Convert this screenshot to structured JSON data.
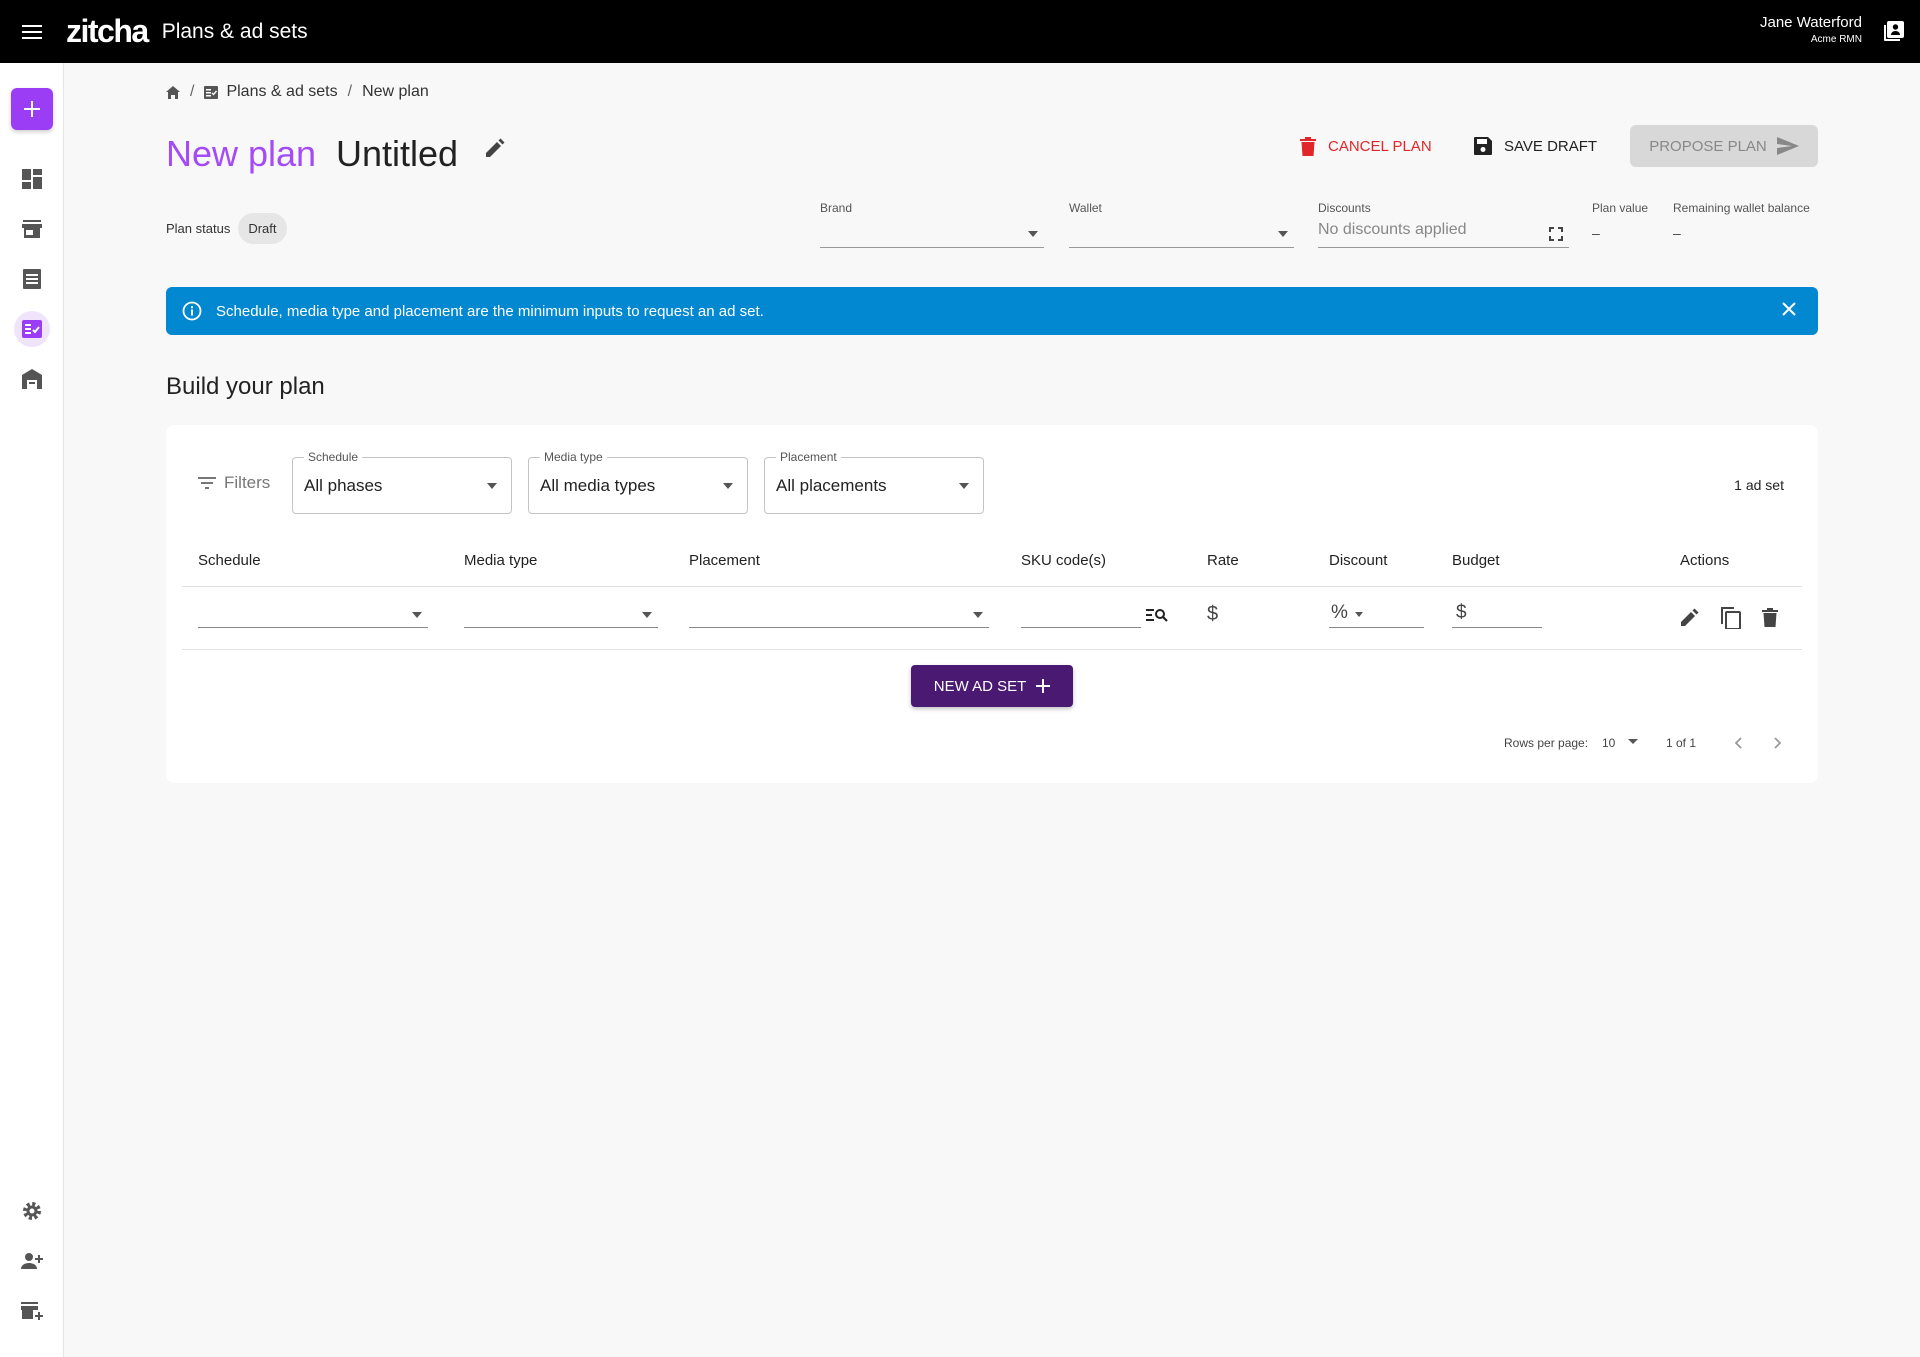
{
  "topbar": {
    "logo": "zitcha",
    "title": "Plans & ad sets",
    "user_name": "Jane Waterford",
    "user_org": "Acme RMN"
  },
  "breadcrumb": {
    "plans": "Plans & ad sets",
    "sep": "/",
    "current": "New plan"
  },
  "header": {
    "new_label": "New plan",
    "plan_name": "Untitled",
    "cancel": "CANCEL PLAN",
    "save": "SAVE DRAFT",
    "propose": "PROPOSE PLAN"
  },
  "status": {
    "label": "Plan status",
    "value": "Draft"
  },
  "fields": {
    "brand": {
      "label": "Brand",
      "value": ""
    },
    "wallet": {
      "label": "Wallet",
      "value": ""
    },
    "discounts": {
      "label": "Discounts",
      "placeholder": "No discounts applied"
    },
    "plan_value": {
      "label": "Plan value",
      "value": "–"
    },
    "wallet_balance": {
      "label": "Remaining wallet balance",
      "value": "–"
    }
  },
  "alert": {
    "text": "Schedule, media type and placement are the minimum inputs to request an ad set."
  },
  "section": {
    "title": "Build your plan"
  },
  "filters": {
    "label": "Filters",
    "schedule": {
      "label": "Schedule",
      "value": "All phases"
    },
    "media_type": {
      "label": "Media type",
      "value": "All media types"
    },
    "placement": {
      "label": "Placement",
      "value": "All placements"
    },
    "count": "1 ad set"
  },
  "table": {
    "headers": {
      "schedule": "Schedule",
      "media_type": "Media type",
      "placement": "Placement",
      "sku": "SKU code(s)",
      "rate": "Rate",
      "discount": "Discount",
      "budget": "Budget",
      "actions": "Actions"
    },
    "row": {
      "rate_symbol": "$",
      "discount_symbol": "%",
      "budget_symbol": "$"
    }
  },
  "new_ad_set": "NEW AD SET",
  "pagination": {
    "rows_label": "Rows per page:",
    "rows_value": "10",
    "range": "1 of 1"
  },
  "colors": {
    "accent": "#a44af6",
    "cancel": "#e0262b",
    "alert": "#0288d1",
    "primary_button": "#4a1a73"
  }
}
